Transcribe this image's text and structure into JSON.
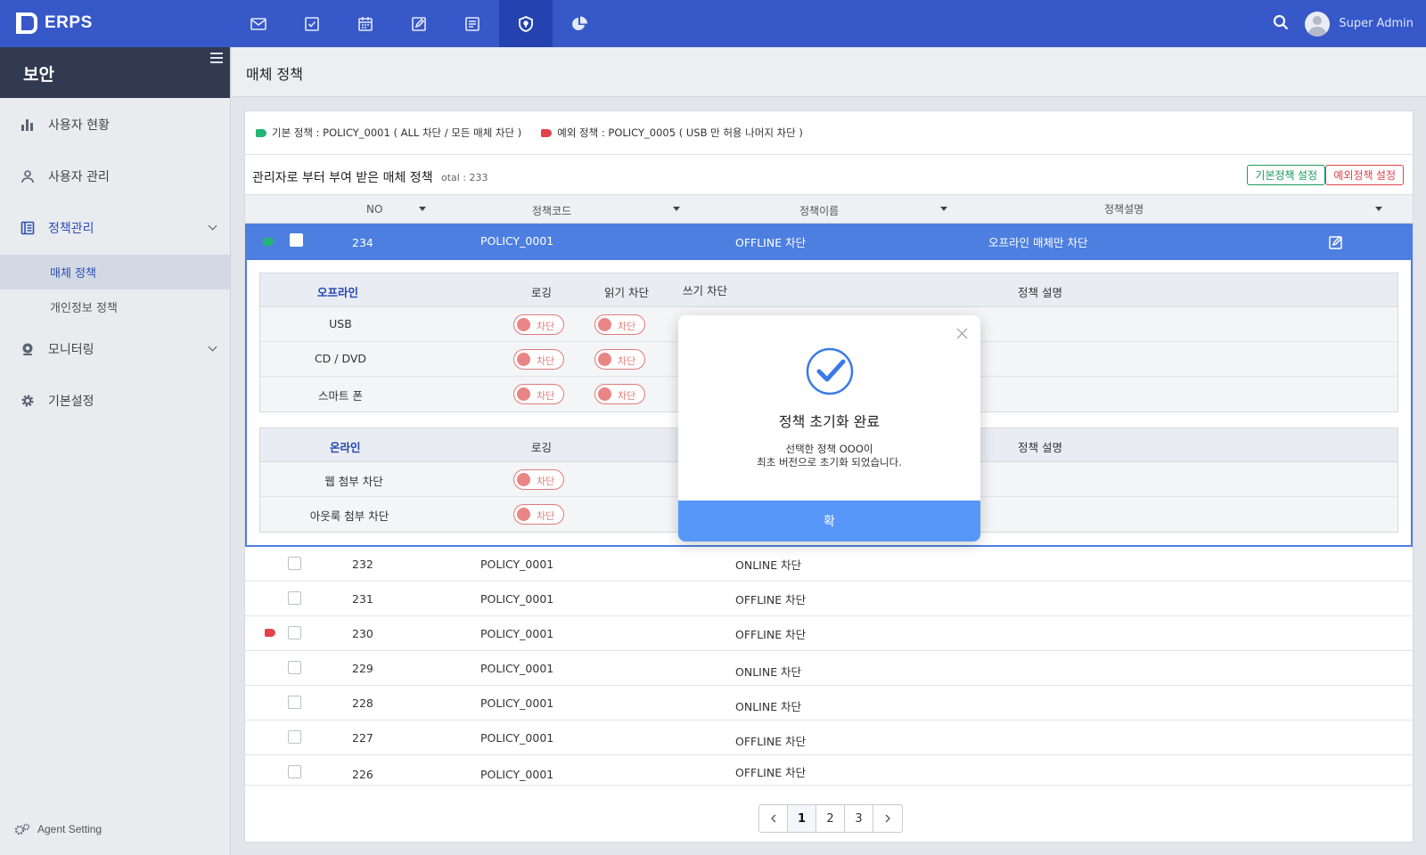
{
  "app": {
    "name": "ERPS"
  },
  "topnav": {
    "items": [
      {
        "icon": "mail-icon"
      },
      {
        "icon": "checkbox-icon"
      },
      {
        "icon": "calendar-icon"
      },
      {
        "icon": "edit-icon"
      },
      {
        "icon": "document-icon"
      },
      {
        "icon": "shield-icon",
        "active": true
      },
      {
        "icon": "pie-chart-icon"
      }
    ],
    "user_name": "Super Admin"
  },
  "sidebar": {
    "title": "보안",
    "items": [
      {
        "label": "사용자 현황",
        "icon": "bar-chart-icon"
      },
      {
        "label": "사용자 관리",
        "icon": "user-icon"
      },
      {
        "label": "정책관리",
        "icon": "policy-icon",
        "open": true
      },
      {
        "label": "모니터링",
        "icon": "webcam-icon"
      },
      {
        "label": "기본설정",
        "icon": "gear-icon"
      }
    ],
    "subitems": [
      {
        "label": "매체 정책",
        "active": true
      },
      {
        "label": "개인정보 정책"
      }
    ],
    "agent_setting": "Agent Setting"
  },
  "page": {
    "title": "매체 정책"
  },
  "legend": {
    "default": "기본 정책 : POLICY_0001 ( ALL 차단 / 모든 매체 차단 )",
    "exception": "예외 정책 : POLICY_0005 ( USB 만 허용 나머지 차단 )"
  },
  "list": {
    "title": "관리자로 부터 부여 받은 매체 정책",
    "total": "otal : 233",
    "btn_default": "기본정책 설정",
    "btn_exception": "예외정책 설정",
    "headers": {
      "no": "NO",
      "code": "정책코드",
      "name": "정책이름",
      "desc": "정책설명"
    },
    "selected_row": {
      "no": "234",
      "code": "POLICY_0001",
      "name": "OFFLINE 차단",
      "desc": "오프라인 매체만 차단",
      "flag": "green"
    },
    "rows": [
      {
        "no": "232",
        "code": "POLICY_0001",
        "name": "ONLINE 차단",
        "flag": ""
      },
      {
        "no": "231",
        "code": "POLICY_0001",
        "name": "OFFLINE 차단",
        "flag": ""
      },
      {
        "no": "230",
        "code": "POLICY_0001",
        "name": "OFFLINE 차단",
        "flag": "red"
      },
      {
        "no": "229",
        "code": "POLICY_0001",
        "name": "ONLINE 차단",
        "flag": ""
      },
      {
        "no": "228",
        "code": "POLICY_0001",
        "name": "ONLINE 차단",
        "flag": ""
      },
      {
        "no": "227",
        "code": "POLICY_0001",
        "name": "OFFLINE 차단",
        "flag": ""
      },
      {
        "no": "226",
        "code": "POLICY_0001",
        "name": "OFFLINE 차단",
        "flag": ""
      }
    ]
  },
  "detail": {
    "offline": {
      "category": "오프라인",
      "headers": {
        "log": "로깅",
        "read": "읽기 차단",
        "write": "쓰기 차단",
        "desc": "정책 설명"
      },
      "rows": [
        {
          "name": "USB",
          "log": "차단",
          "read": "차단"
        },
        {
          "name": "CD / DVD",
          "log": "차단",
          "read": "차단"
        },
        {
          "name": "스마트 폰",
          "log": "차단",
          "read": "차단"
        }
      ]
    },
    "online": {
      "category": "온라인",
      "headers": {
        "log": "로깅",
        "desc": "정책 설명"
      },
      "rows": [
        {
          "name": "웹 첨부 차단",
          "log": "차단"
        },
        {
          "name": "아웃룩 첨부 차단",
          "log": "차단"
        }
      ]
    }
  },
  "pagination": {
    "pages": [
      "1",
      "2",
      "3"
    ],
    "current": "1"
  },
  "modal": {
    "title": "정책 초기화 완료",
    "message_line1": "선택한 정책 OOO이",
    "message_line2": "최초 버전으로 초기화 되었습니다.",
    "confirm": "확"
  },
  "colors": {
    "primary": "#3758c8",
    "selected_row": "#4d7fe0",
    "green": "#22b573",
    "red": "#e2434b",
    "modal_button": "#5797f7"
  }
}
